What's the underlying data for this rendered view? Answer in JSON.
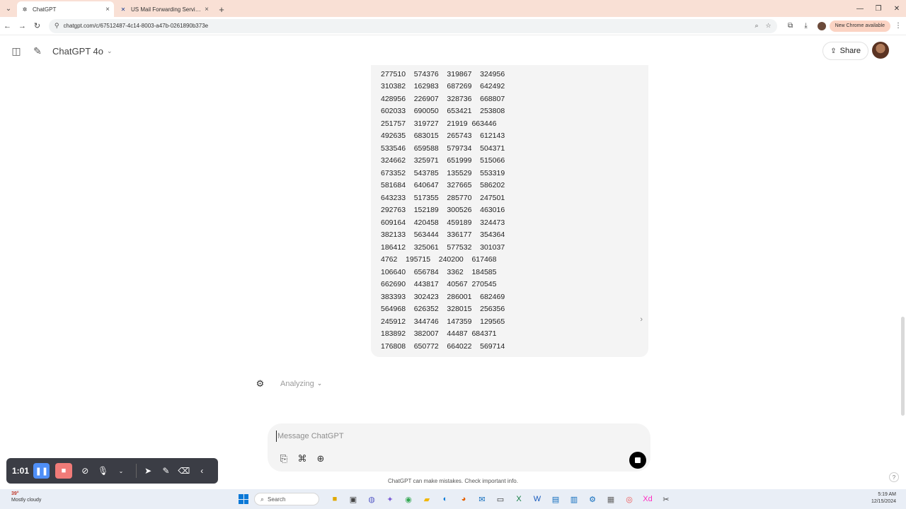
{
  "browser": {
    "tabs": [
      {
        "label": "ChatGPT",
        "favicon": "chatgpt-icon",
        "active": true
      },
      {
        "label": "US Mail Forwarding Service | St...",
        "favicon": "mail-icon",
        "active": false
      }
    ],
    "url": "chatgpt.com/c/67512487-4c14-8003-a47b-0261890b373e",
    "new_chrome_label": "New Chrome available"
  },
  "header": {
    "model": "ChatGPT 4o",
    "share_label": "Share"
  },
  "data_rows": [
    "277510    574376    319867    324956",
    "310382    162983    687269    642492",
    "428956    226907    328736    668807",
    "602033    690050    653421    253808",
    "251757    319727    21919  663446",
    "492635    683015    265743    612143",
    "533546    659588    579734    504371",
    "324662    325971    651999    515066",
    "673352    543785    135529    553319",
    "581684    640647    327665    586202",
    "643233    517355    285770    247501",
    "292763    152189    300526    463016",
    "609164    420458    459189    324473",
    "382133    563444    336177    354364",
    "186412    325061    577532    301037",
    "4762    195715    240200    617468",
    "106640    656784    3362    184585",
    "662690    443817    40567  270545",
    "383393    302423    286001    682469",
    "564968    626352    328015    256356",
    "245912    344746    147359    129565",
    "183892    382007    44487  684371",
    "176808    650772    664022    569714"
  ],
  "status": {
    "analyzing_label": "Analyzing"
  },
  "composer": {
    "placeholder": "Message ChatGPT",
    "value": ""
  },
  "footer": {
    "disclaimer": "ChatGPT can make mistakes. Check important info.",
    "help": "?"
  },
  "recorder": {
    "time": "1:01"
  },
  "taskbar": {
    "weather_temp": "39°",
    "weather_desc": "Mostly cloudy",
    "search_label": "Search",
    "time": "5:19 AM",
    "date": "12/15/2024"
  }
}
